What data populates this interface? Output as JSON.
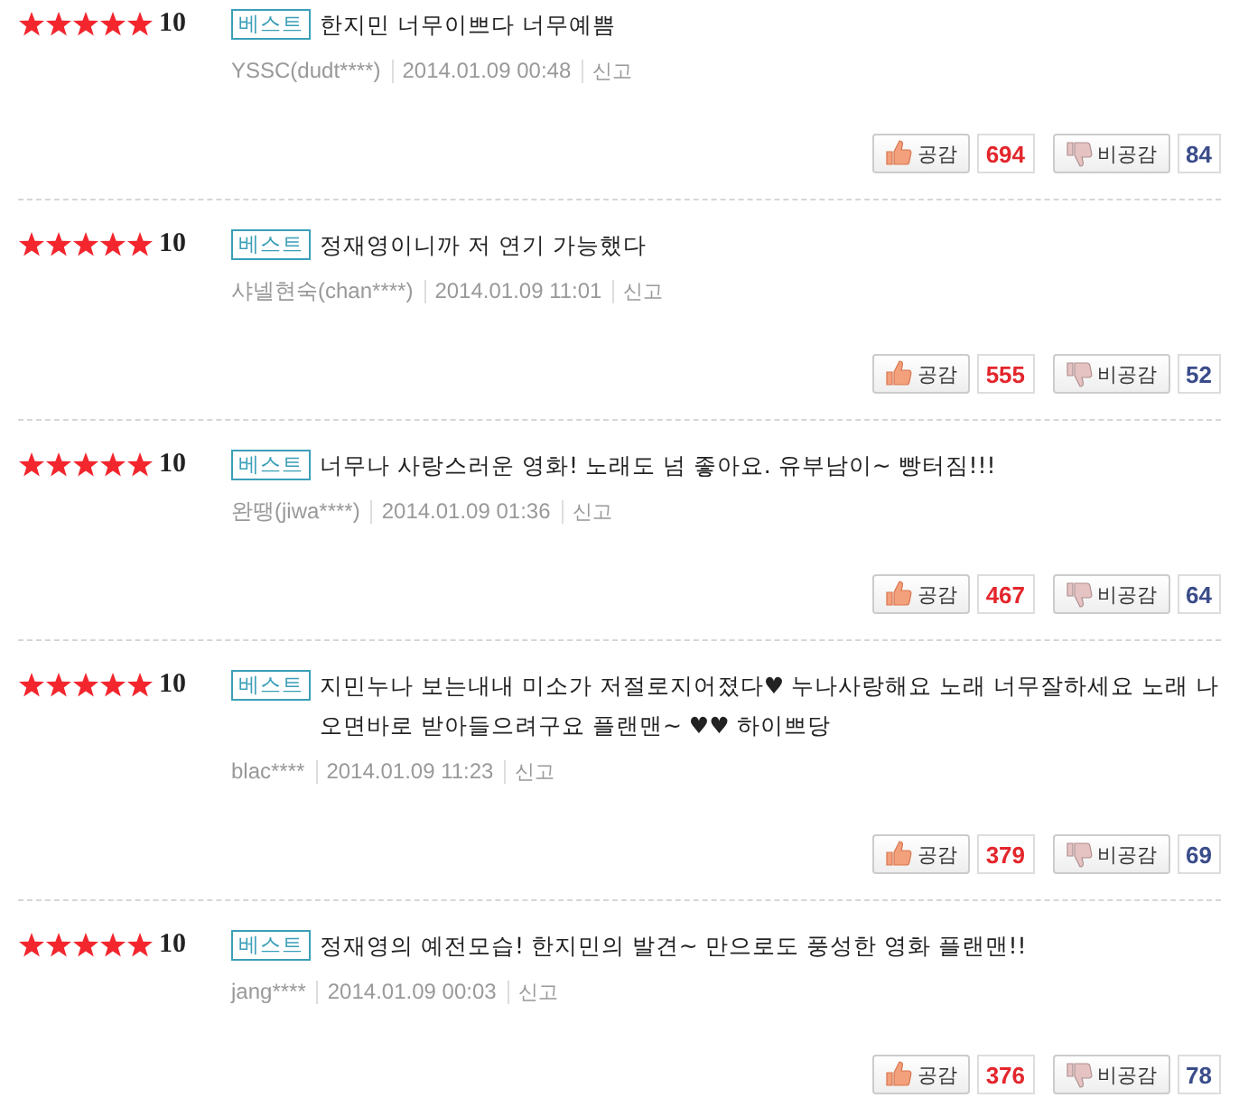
{
  "reviews": [
    {
      "stars": 5,
      "score": "10",
      "badge": "베스트",
      "text": "한지민 너무이쁘다 너무예쁨",
      "author": "YSSC(dudt****)",
      "date": "2014.01.09 00:48",
      "report": "신고",
      "like_label": "공감",
      "likes": "694",
      "dislike_label": "비공감",
      "dislikes": "84"
    },
    {
      "stars": 5,
      "score": "10",
      "badge": "베스트",
      "text": "정재영이니까 저 연기 가능했다",
      "author": "샤넬현숙(chan****)",
      "date": "2014.01.09 11:01",
      "report": "신고",
      "like_label": "공감",
      "likes": "555",
      "dislike_label": "비공감",
      "dislikes": "52"
    },
    {
      "stars": 5,
      "score": "10",
      "badge": "베스트",
      "text": "너무나 사랑스러운 영화! 노래도 넘 좋아요. 유부남이~ 빵터짐!!!",
      "author": "완땡(jiwa****)",
      "date": "2014.01.09 01:36",
      "report": "신고",
      "like_label": "공감",
      "likes": "467",
      "dislike_label": "비공감",
      "dislikes": "64"
    },
    {
      "stars": 5,
      "score": "10",
      "badge": "베스트",
      "text": "지민누나 보는내내 미소가 저절로지어졌다♥ 누나사랑해요 노래 너무잘하세요 노래 나오면바로 받아들으려구요 플랜맨~ ♥♥ 하이쁘당",
      "author": "blac****",
      "date": "2014.01.09 11:23",
      "report": "신고",
      "like_label": "공감",
      "likes": "379",
      "dislike_label": "비공감",
      "dislikes": "69"
    },
    {
      "stars": 5,
      "score": "10",
      "badge": "베스트",
      "text": "정재영의 예전모습! 한지민의 발견~ 만으로도 풍성한 영화 플랜맨!!",
      "author": "jang****",
      "date": "2014.01.09 00:03",
      "report": "신고",
      "like_label": "공감",
      "likes": "376",
      "dislike_label": "비공감",
      "dislikes": "78"
    }
  ]
}
